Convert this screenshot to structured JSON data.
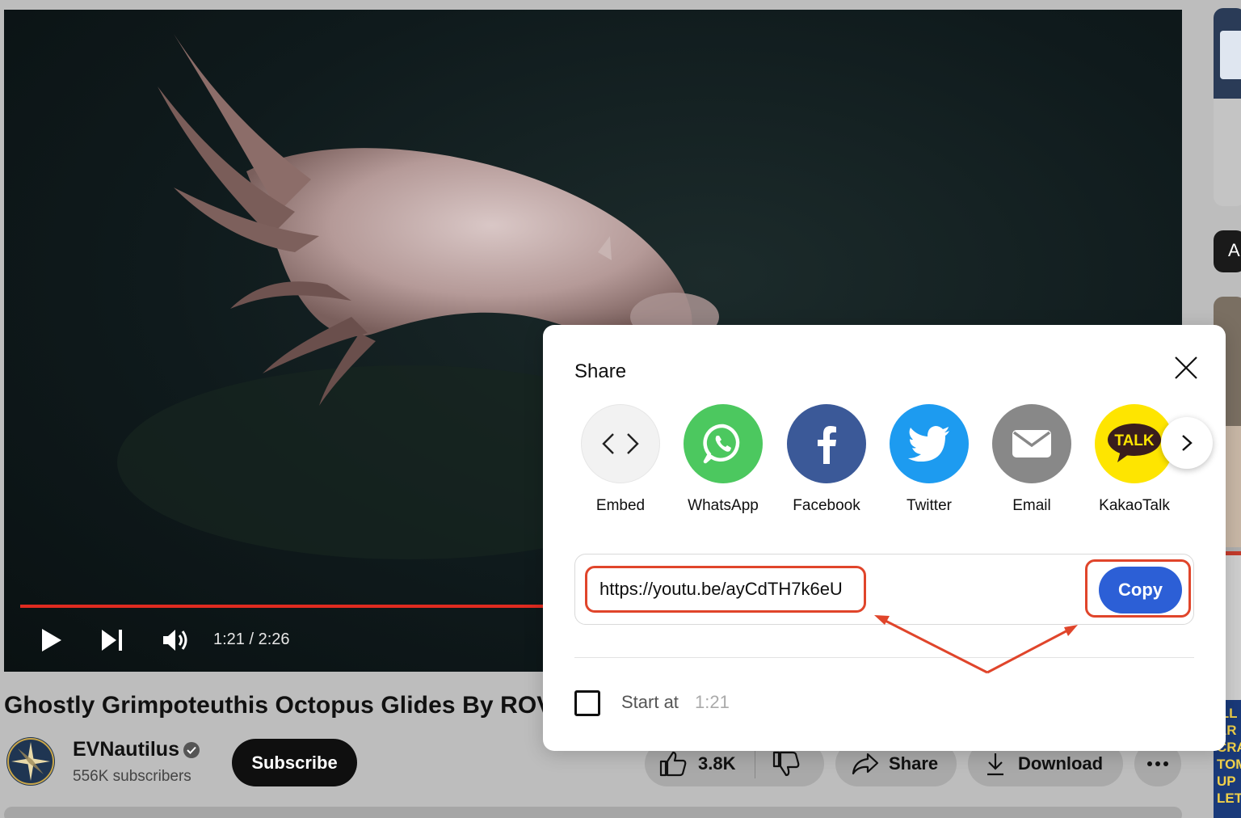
{
  "player": {
    "time": "1:21 / 2:26",
    "progress": 0.554
  },
  "video": {
    "title": "Ghostly Grimpoteuthis Octopus Glides By ROV H"
  },
  "channel": {
    "name": "EVNautilus",
    "subscribers": "556K subscribers",
    "subscribe_label": "Subscribe"
  },
  "actions": {
    "likes": "3.8K",
    "share_label": "Share",
    "download_label": "Download"
  },
  "sidebar": {
    "chip_text": "A",
    "thumb_text": "ILL\nAR\nCRA\nTOM\nUP\nLET"
  },
  "share_dialog": {
    "title": "Share",
    "targets": [
      {
        "label": "Embed",
        "icon": "embed-icon",
        "color": "#f2f2f2"
      },
      {
        "label": "WhatsApp",
        "icon": "whatsapp-icon",
        "color": "#4cc85f"
      },
      {
        "label": "Facebook",
        "icon": "facebook-icon",
        "color": "#3b5998"
      },
      {
        "label": "Twitter",
        "icon": "twitter-icon",
        "color": "#1d9bf0"
      },
      {
        "label": "Email",
        "icon": "email-icon",
        "color": "#888888"
      },
      {
        "label": "KakaoTalk",
        "icon": "kakaotalk-icon",
        "color": "#fee500",
        "badge": "TALK"
      }
    ],
    "url": "https://youtu.be/ayCdTH7k6eU",
    "copy_label": "Copy",
    "start_at_label": "Start at",
    "start_at_time": "1:21",
    "start_at_checked": false
  },
  "colors": {
    "accent": "#2c5fd6",
    "progress": "#e02b20",
    "highlight": "#e0452b"
  }
}
